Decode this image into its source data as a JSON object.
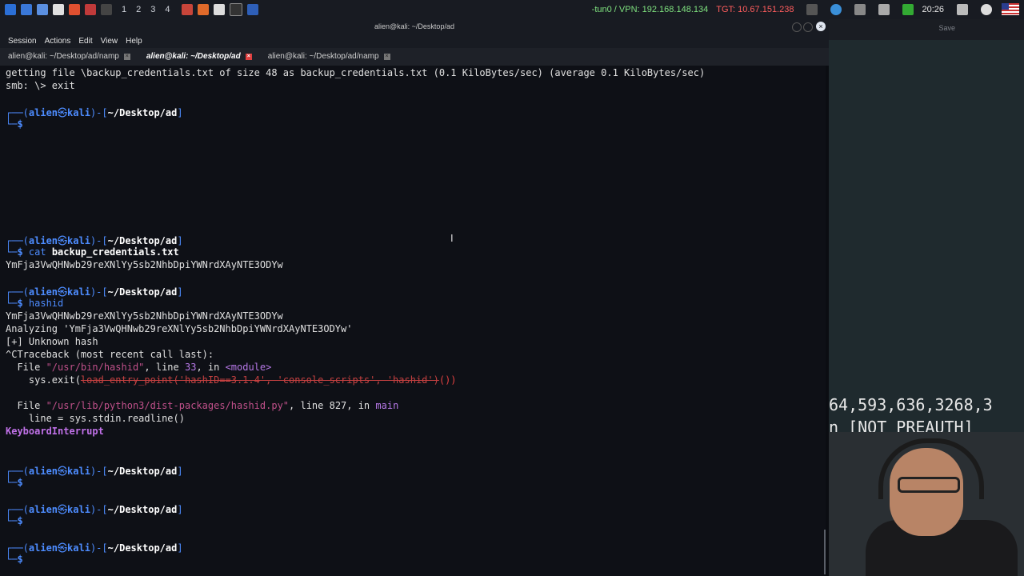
{
  "taskbar": {
    "workspaces": [
      "1",
      "2",
      "3",
      "4"
    ],
    "vpn": "-tun0 / VPN: 192.168.148.134",
    "target": "TGT: 10.67.151.238",
    "clock": "20:26"
  },
  "window": {
    "title": "alien@kali: ~/Desktop/ad"
  },
  "menu": [
    "Session",
    "Actions",
    "Edit",
    "View",
    "Help"
  ],
  "tabs": [
    {
      "label": "alien@kali: ~/Desktop/ad/namp",
      "active": false
    },
    {
      "label": "alien@kali: ~/Desktop/ad",
      "active": true
    },
    {
      "label": "alien@kali: ~/Desktop/ad/namp",
      "active": false
    }
  ],
  "terminal": {
    "l1": "getting file \\backup_credentials.txt of size 48 as backup_credentials.txt (0.1 KiloBytes/sec) (average 0.1 KiloBytes/sec)",
    "l2": "smb: \\> exit",
    "prompt_user": "alien",
    "prompt_at": "㉿",
    "prompt_host": "kali",
    "prompt_dir": "~/Desktop/ad",
    "cmd_cat": "cat ",
    "cmd_cat_arg": "backup_credentials.txt",
    "cred_out": "YmFja3VwQHNwb29reXNlYy5sb2NhbDpiYWNrdXAyNTE3ODYw",
    "cmd_hashid": "hashid",
    "hash_in": "YmFja3VwQHNwb29reXNlYy5sb2NhbDpiYWNrdXAyNTE3ODYw",
    "analyzing": "Analyzing 'YmFja3VwQHNwb29reXNlYy5sb2NhbDpiYWNrdXAyNTE3ODYw'",
    "unknown": "[+] Unknown hash",
    "traceback": "^CTraceback (most recent call last):",
    "file1_pre": "  File ",
    "file1_path": "\"/usr/bin/hashid\"",
    "file1_mid": ", line ",
    "file1_line": "33",
    "file1_in": ", in ",
    "file1_mod": "<module>",
    "sysexit_pre": "    sys.exit(",
    "sysexit_struck": "load_entry_point('hashID==3.1.4', 'console_scripts', 'hashid')",
    "sysexit_post": "())",
    "file2_pre": "  File ",
    "file2_path": "\"/usr/lib/python3/dist-packages/hashid.py\"",
    "file2_mid": ", line 827, in ",
    "file2_func": "main",
    "readline": "    line = sys.stdin.readline()",
    "kbi": "KeyboardInterrupt"
  },
  "overlay": {
    "ports": "64,593,636,3268,3",
    "preauth": "n [NOT PREAUTH]",
    "save": "Save"
  }
}
